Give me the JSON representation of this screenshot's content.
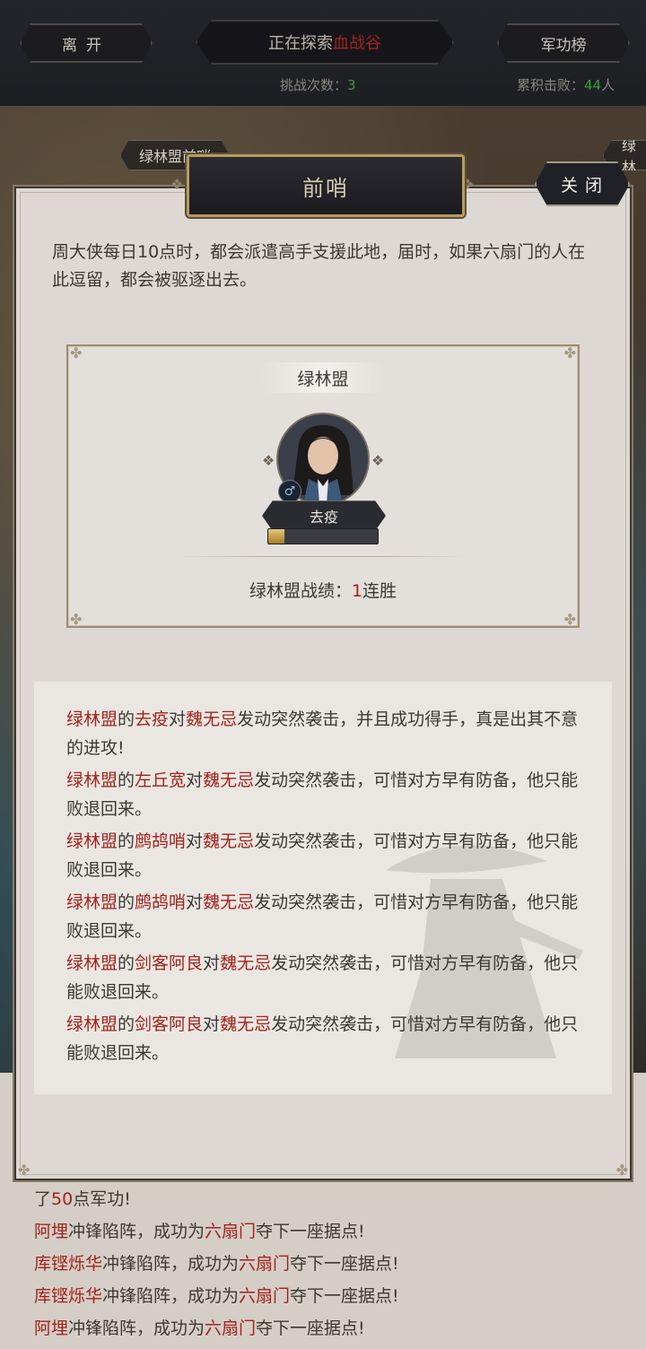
{
  "topbar": {
    "leave_label": "离开",
    "exploring_prefix": "正在探索",
    "exploring_place": "血战谷",
    "rank_label": "军功榜",
    "challenge_label": "挑战次数：",
    "challenge_value": "3",
    "kills_label": "累积击败：",
    "kills_value": "44",
    "kills_unit": "人"
  },
  "map_tags": [
    "绿林盟前哨",
    "绿林"
  ],
  "modal": {
    "title": "前哨",
    "close_label": "关闭",
    "description": "周大侠每日10点时，都会派遣高手支援此地，届时，如果六扇门的人在此逗留，都会被驱逐出去。",
    "card": {
      "faction": "绿林盟",
      "gender_icon": "♂",
      "character_name": "去疫",
      "progress": 0.15,
      "record_label": "绿林盟战绩：",
      "record_value": "1",
      "record_suffix": "连胜"
    },
    "log": [
      {
        "faction": "绿林盟",
        "de": "的",
        "attacker": "去疫",
        "dui": "对",
        "target": "魏无忌",
        "text": "发动突然袭击，并且成功得手，真是出其不意的进攻!"
      },
      {
        "faction": "绿林盟",
        "de": "的",
        "attacker": "左丘宽",
        "dui": "对",
        "target": "魏无忌",
        "text": "发动突然袭击，可惜对方早有防备，他只能败退回来。"
      },
      {
        "faction": "绿林盟",
        "de": "的",
        "attacker": "鹧鸪哨",
        "dui": "对",
        "target": "魏无忌",
        "text": "发动突然袭击，可惜对方早有防备，他只能败退回来。"
      },
      {
        "faction": "绿林盟",
        "de": "的",
        "attacker": "鹧鸪哨",
        "dui": "对",
        "target": "魏无忌",
        "text": "发动突然袭击，可惜对方早有防备，他只能败退回来。"
      },
      {
        "faction": "绿林盟",
        "de": "的",
        "attacker": "剑客阿良",
        "dui": "对",
        "target": "魏无忌",
        "text": "发动突然袭击，可惜对方早有防备，他只能败退回来。"
      },
      {
        "faction": "绿林盟",
        "de": "的",
        "attacker": "剑客阿良",
        "dui": "对",
        "target": "魏无忌",
        "text": "发动突然袭击，可惜对方早有防备，他只能败退回来。"
      }
    ]
  },
  "background_log": {
    "line1_prefix": "了",
    "line1_value": "50",
    "line1_suffix": "点军功!",
    "lines": [
      {
        "name": "阿埋",
        "mid": "冲锋陷阵，成功为",
        "org": "六扇门",
        "end": "夺下一座据点!"
      },
      {
        "name": "库铿烁华",
        "mid": "冲锋陷阵，成功为",
        "org": "六扇门",
        "end": "夺下一座据点!"
      },
      {
        "name": "库铿烁华",
        "mid": "冲锋陷阵，成功为",
        "org": "六扇门",
        "end": "夺下一座据点!"
      },
      {
        "name": "阿埋",
        "mid": "冲锋陷阵，成功为",
        "org": "六扇门",
        "end": "夺下一座据点!"
      }
    ]
  }
}
